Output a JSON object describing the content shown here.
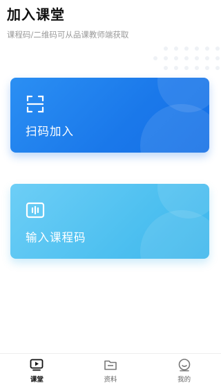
{
  "header": {
    "title": "加入课堂",
    "subtitle": "课程码/二维码可从品课教师端获取"
  },
  "cards": {
    "scan": {
      "label": "扫码加入",
      "icon": "scan-frame-icon",
      "color": "#1a78ea"
    },
    "code": {
      "label": "输入课程码",
      "icon": "course-code-icon",
      "color": "#4ec0f0"
    }
  },
  "tabbar": {
    "tabs": [
      {
        "label": "课堂",
        "icon": "play-screen-icon",
        "active": true
      },
      {
        "label": "资料",
        "icon": "folder-icon",
        "active": false
      },
      {
        "label": "我的",
        "icon": "smile-face-icon",
        "active": false
      }
    ]
  }
}
